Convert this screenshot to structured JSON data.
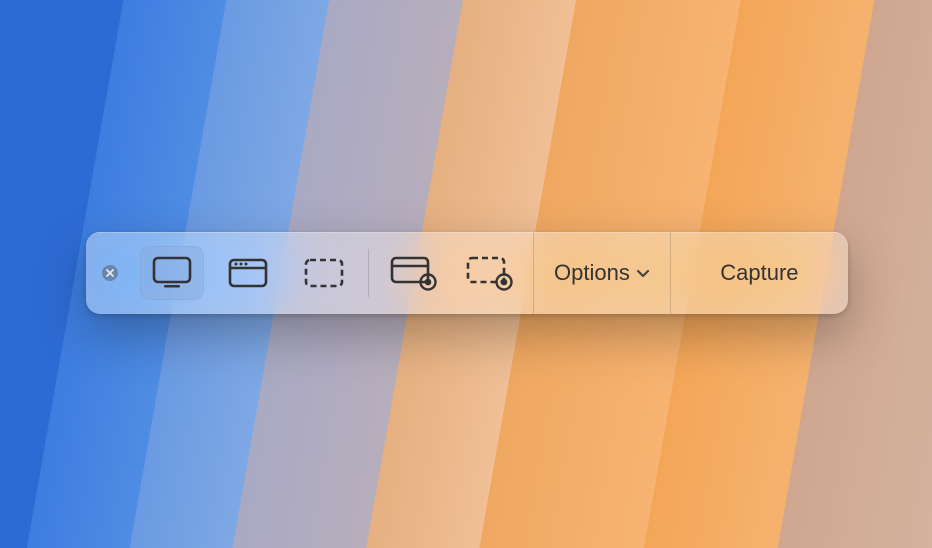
{
  "toolbar": {
    "close_name": "close",
    "tools": [
      {
        "name": "capture-entire-screen",
        "kind": "screen_full",
        "selected": true
      },
      {
        "name": "capture-selected-window",
        "kind": "window",
        "selected": false
      },
      {
        "name": "capture-selected-portion",
        "kind": "selection",
        "selected": false
      },
      {
        "name": "record-entire-screen",
        "kind": "record_screen",
        "selected": false
      },
      {
        "name": "record-selected-portion",
        "kind": "record_selection",
        "selected": false
      }
    ],
    "options_label": "Options",
    "capture_label": "Capture"
  }
}
